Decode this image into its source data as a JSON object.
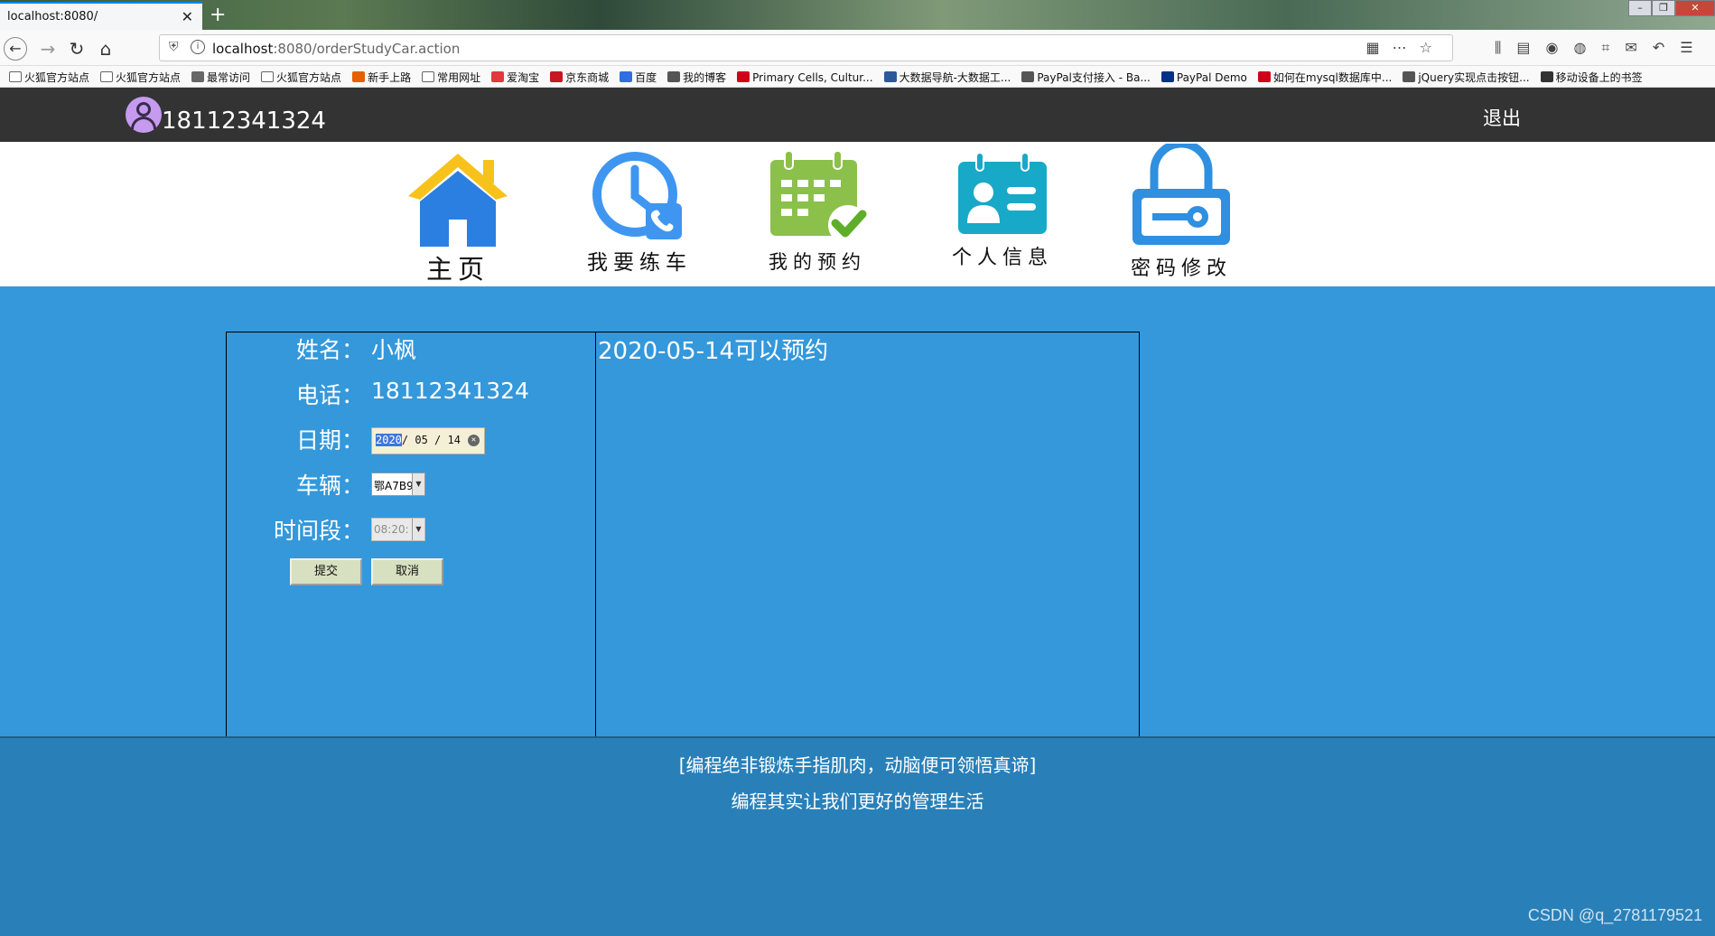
{
  "browser": {
    "tab_title": "localhost:8080/",
    "url_host": "localhost",
    "url_path": ":8080/orderStudyCar.action",
    "bookmarks": [
      "火狐官方站点",
      "火狐官方站点",
      "最常访问",
      "火狐官方站点",
      "新手上路",
      "常用网址",
      "爱淘宝",
      "京东商城",
      "百度",
      "我的博客",
      "Primary Cells, Cultur...",
      "大数据导航-大数据工...",
      "PayPal支付接入 - Ba...",
      "PayPal Demo",
      "如何在mysql数据库中...",
      "jQuery实现点击按钮...",
      "移动设备上的书签"
    ]
  },
  "header": {
    "user_phone": "18112341324",
    "logout_label": "退出"
  },
  "nav": {
    "home": "主页",
    "practice": "我要练车",
    "appointments": "我的预约",
    "profile": "个人信息",
    "password": "密码修改"
  },
  "form": {
    "name_label": "姓名：",
    "name_value": "小枫",
    "phone_label": "电话：",
    "phone_value": "18112341324",
    "date_label": "日期：",
    "date_year": "2020",
    "date_rest": "/ 05 / 14",
    "car_label": "车辆：",
    "car_value": "鄂A7B9",
    "time_label": "时间段：",
    "time_value": "08:20:",
    "submit_label": "提交",
    "cancel_label": "取消"
  },
  "info": {
    "message": "2020-05-14可以预约"
  },
  "footer": {
    "line1": "[编程绝非锻炼手指肌肉，动脑便可领悟真谛]",
    "line2": "编程其实让我们更好的管理生活",
    "watermark": "CSDN @q_2781179521"
  },
  "colors": {
    "main_bg": "#3498db",
    "topbar_bg": "#333333",
    "footer_bg": "#2980b9",
    "home_roof": "#f8c21c",
    "home_body": "#2b7fe0"
  }
}
